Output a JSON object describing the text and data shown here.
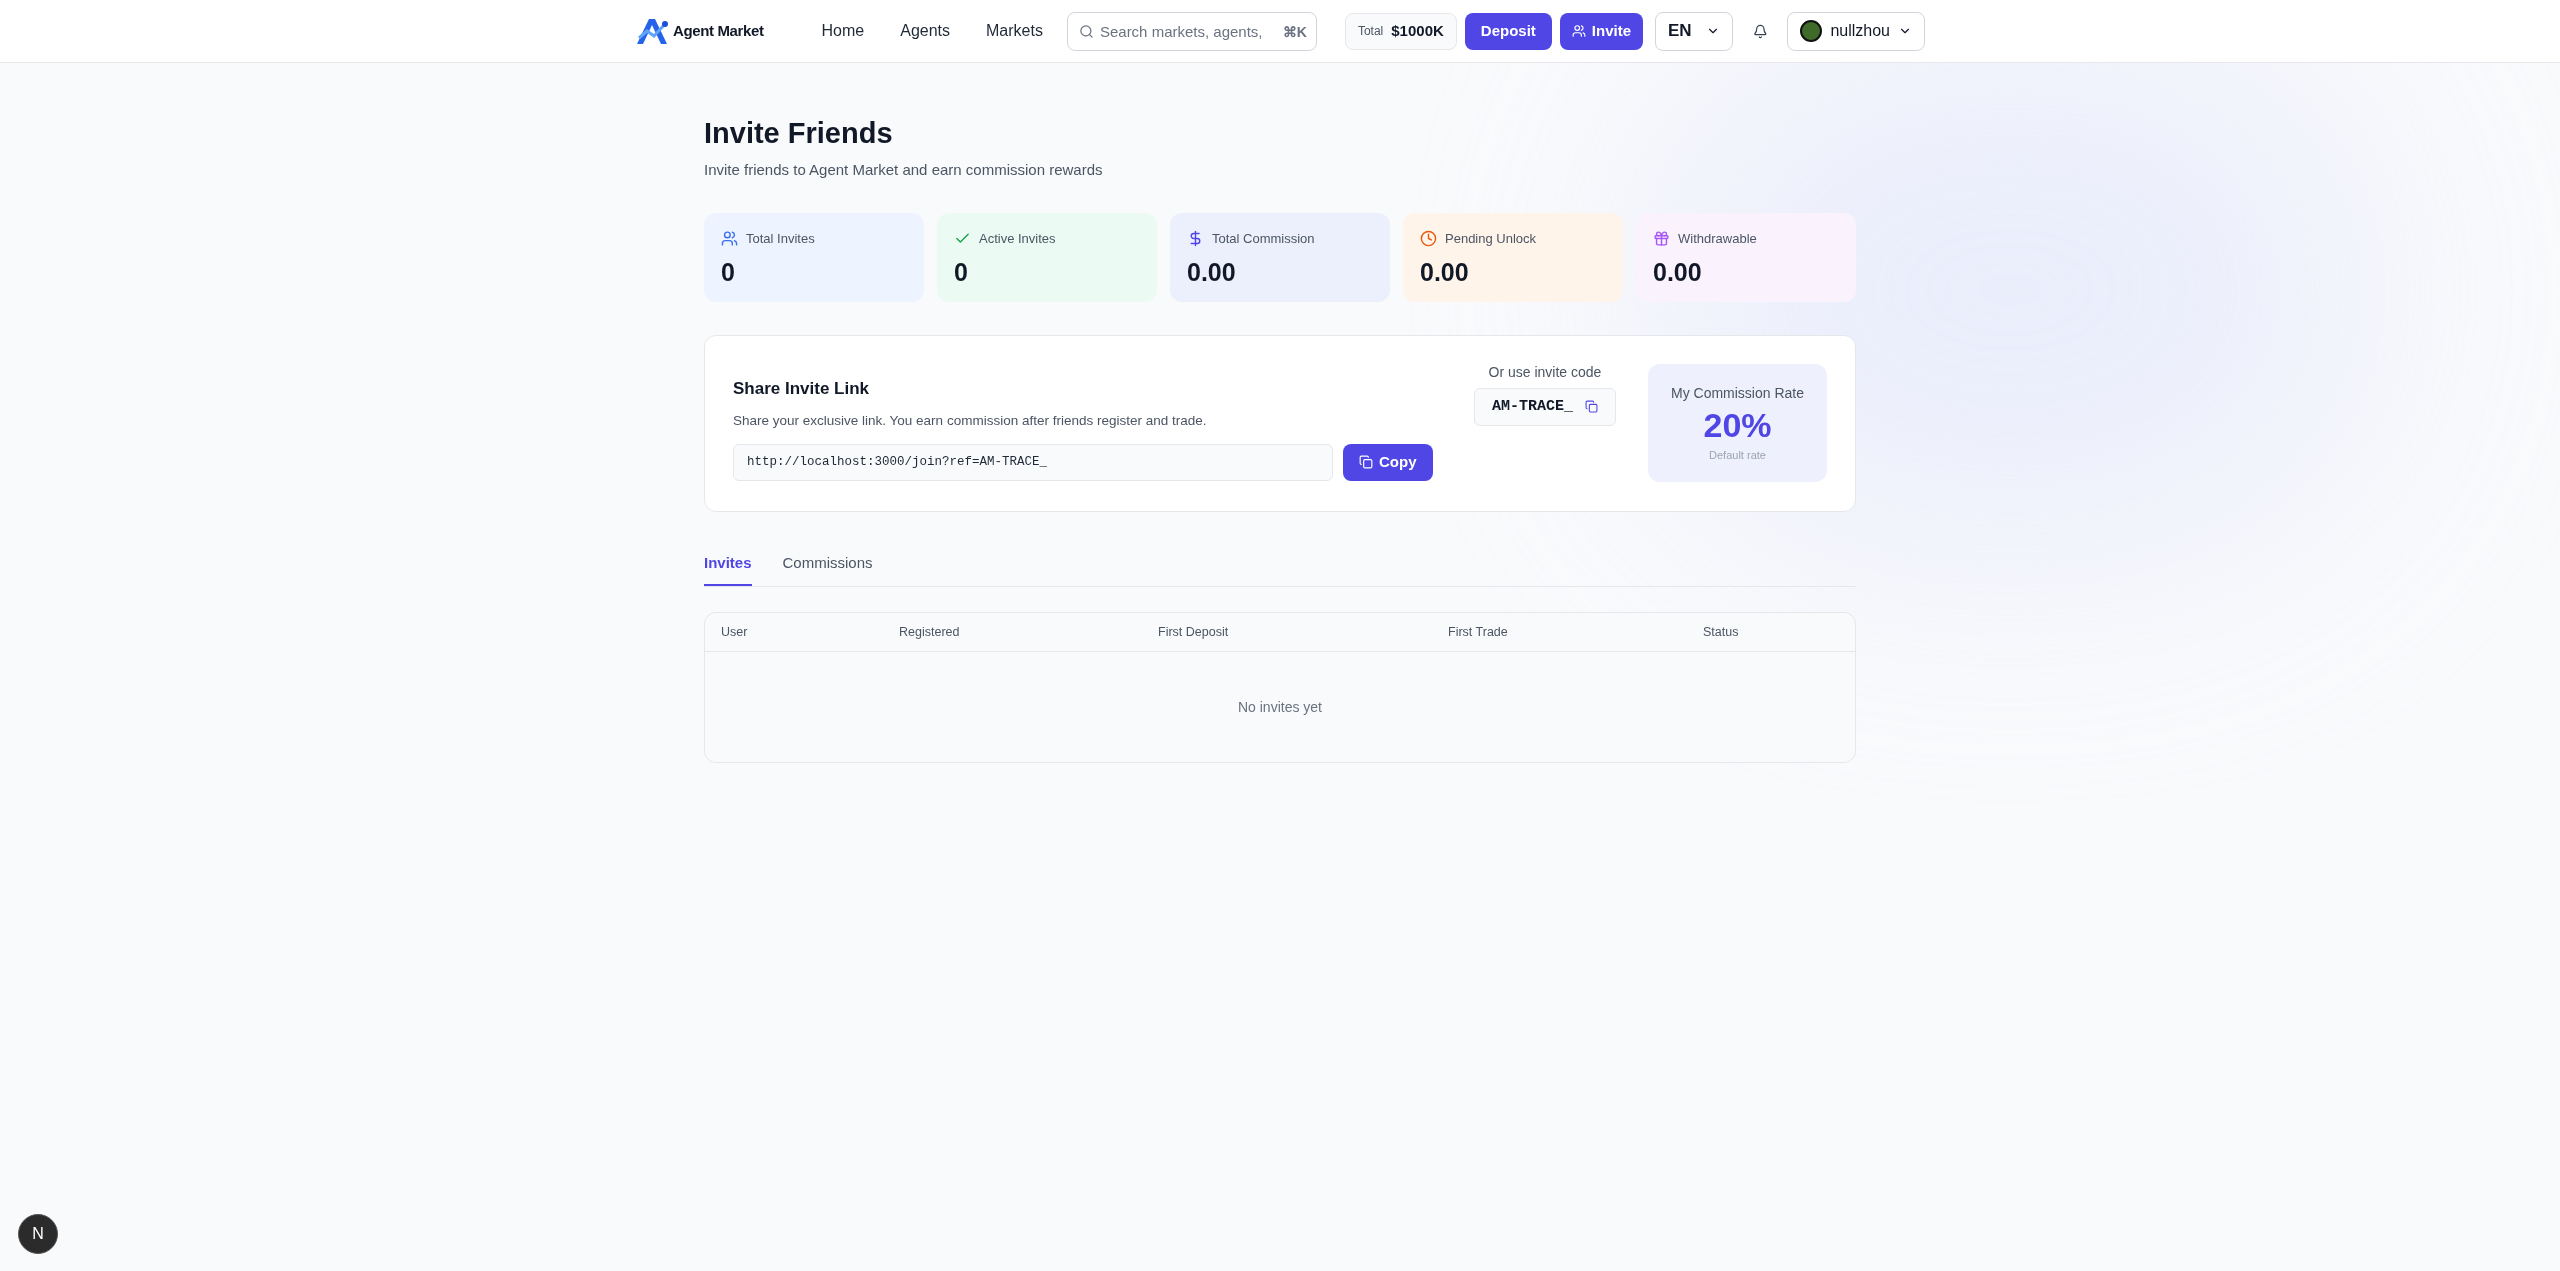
{
  "header": {
    "brand": "Agent Market",
    "nav": [
      {
        "label": "Home"
      },
      {
        "label": "Agents"
      },
      {
        "label": "Markets"
      }
    ],
    "search": {
      "placeholder": "Search markets, agents,",
      "shortcut": "⌘K"
    },
    "balance": {
      "label": "Total",
      "value": "$1000K"
    },
    "deposit_button": "Deposit",
    "invite_button": "Invite",
    "language": "EN",
    "user": "nullzhou"
  },
  "page": {
    "title": "Invite Friends",
    "subtitle": "Invite friends to Agent Market and earn commission rewards"
  },
  "stats": [
    {
      "kind": "invites",
      "label": "Total Invites",
      "value": "0"
    },
    {
      "kind": "active",
      "label": "Active Invites",
      "value": "0"
    },
    {
      "kind": "commission",
      "label": "Total Commission",
      "value": "0.00"
    },
    {
      "kind": "pending",
      "label": "Pending Unlock",
      "value": "0.00"
    },
    {
      "kind": "withdrawable",
      "label": "Withdrawable",
      "value": "0.00"
    }
  ],
  "share": {
    "title": "Share Invite Link",
    "description": "Share your exclusive link. You earn commission after friends register and trade.",
    "link": "http://localhost:3000/join?ref=AM-TRACE_",
    "copy_button": "Copy",
    "code_label": "Or use invite code",
    "code": "AM-TRACE_",
    "rate_label": "My Commission Rate",
    "rate": "20%",
    "rate_note": "Default rate"
  },
  "tabs": [
    {
      "label": "Invites",
      "selected": true
    },
    {
      "label": "Commissions",
      "selected": false
    }
  ],
  "table": {
    "columns": [
      "User",
      "Registered",
      "First Deposit",
      "First Trade",
      "Status"
    ],
    "empty": "No invites yet"
  },
  "dev_badge": "N"
}
